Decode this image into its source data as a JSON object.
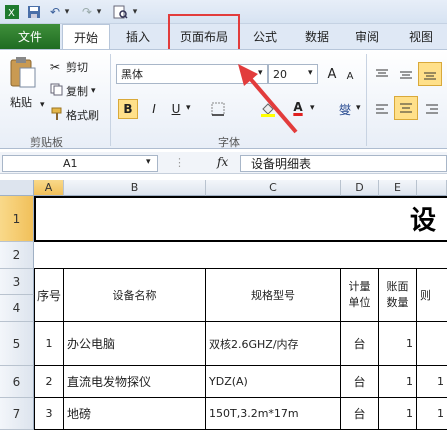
{
  "qat": {
    "dropdown_arrow": "▾",
    "undo": "↶",
    "redo": "↷"
  },
  "tabs": {
    "file": "文件",
    "home": "开始",
    "insert": "插入",
    "page_layout": "页面布局",
    "formulas": "公式",
    "data": "数据",
    "review": "审阅",
    "view": "视图"
  },
  "clipboard": {
    "paste": "粘贴",
    "cut": "剪切",
    "copy": "复制",
    "format_painter": "格式刷",
    "group_label": "剪贴板"
  },
  "font": {
    "name": "黑体",
    "size": "20",
    "grow": "A",
    "shrink": "A",
    "bold": "B",
    "italic": "I",
    "underline": "U",
    "font_color": "A",
    "phonetic": "燮",
    "group_label": "字体"
  },
  "formula_bar": {
    "name_box": "A1",
    "fx": "fx",
    "content": "设备明细表"
  },
  "columns": [
    "A",
    "B",
    "C",
    "D",
    "E"
  ],
  "rows": [
    "1",
    "2",
    "3",
    "4",
    "5",
    "6",
    "7"
  ],
  "title_cell": "设",
  "headers": {
    "seq": "序号",
    "name": "设备名称",
    "spec": "规格型号",
    "unit_l1": "计量",
    "unit_l2": "单位",
    "qty_l1": "账面",
    "qty_l2": "数量",
    "extra": "则"
  },
  "items": [
    {
      "seq": "1",
      "name": "办公电脑",
      "spec": "双核2.6GHZ/内存",
      "unit": "台",
      "qty": "1",
      "extra": ""
    },
    {
      "seq": "2",
      "name": "直流电发物探仪",
      "spec": "YDZ(A)",
      "unit": "台",
      "qty": "1",
      "extra": "1"
    },
    {
      "seq": "3",
      "name": "地磅",
      "spec": "150T,3.2m*17m",
      "unit": "台",
      "qty": "1",
      "extra": "1"
    }
  ],
  "colors": {
    "annotation_red": "#e23c3c",
    "file_tab": "#2a7a2c"
  }
}
